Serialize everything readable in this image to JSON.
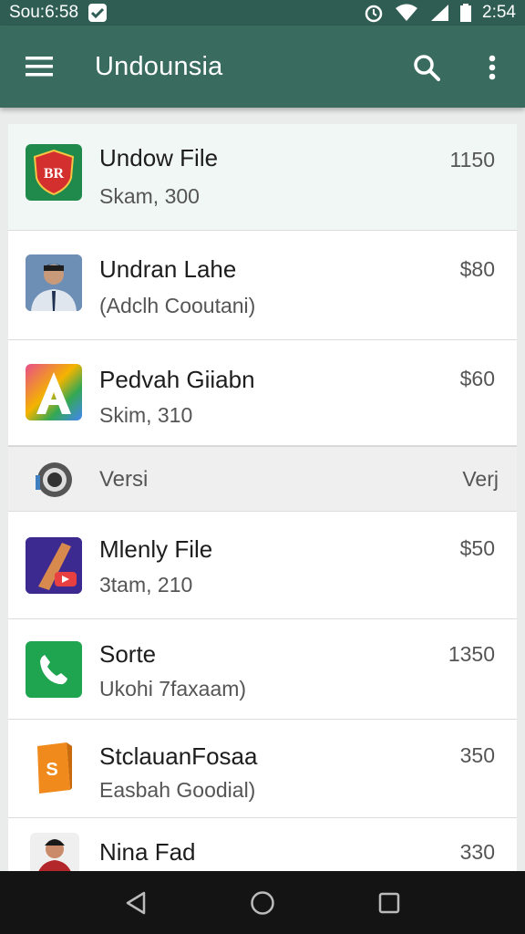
{
  "status_bar": {
    "left_text": "Sou:6:58",
    "time": "2:54"
  },
  "app_bar": {
    "title": "Undounsia"
  },
  "rows": [
    {
      "primary": "Undow File",
      "secondary": "Skam, 300",
      "value": "1150",
      "icon": "shield-icon",
      "icon_text": "BR"
    },
    {
      "primary": "Undran Lahe",
      "secondary": "(Adclh Cooutani)",
      "value": "$80",
      "icon": "person-photo-icon"
    },
    {
      "primary": "Pedvah Giiabn",
      "secondary": "Skim, 310",
      "value": "$60",
      "icon": "letter-a-icon"
    },
    {
      "primary": "Versi",
      "value": "Verj",
      "icon": "camera-lens-icon"
    },
    {
      "primary": "Mlenly File",
      "secondary": "3tam, 210",
      "value": "$50",
      "icon": "photo-app-icon"
    },
    {
      "primary": "Sorte",
      "secondary": "Ukohi 7faxaam)",
      "value": "1350",
      "icon": "phone-icon"
    },
    {
      "primary": "StclauanFosaa",
      "secondary": "Easbah Goodial)",
      "value": "350",
      "icon": "shopping-bag-icon",
      "icon_text": "S"
    },
    {
      "primary": "Nina Fad",
      "value": "330",
      "icon": "person-avatar-icon"
    }
  ],
  "colors": {
    "status_bar": "#2f5d53",
    "app_bar": "#3a6b5f",
    "nav_bar": "#141414",
    "highlight_row": "#f1f7f4"
  }
}
